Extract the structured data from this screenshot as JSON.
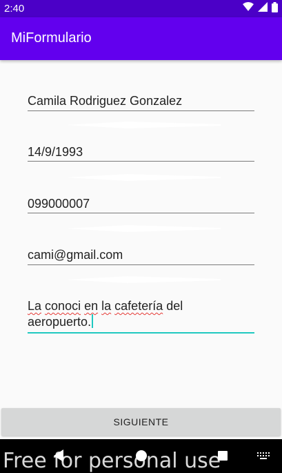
{
  "status_bar": {
    "time": "2:40",
    "icons": [
      "wifi-icon",
      "signal-icon",
      "battery-icon"
    ]
  },
  "app_bar": {
    "title": "MiFormulario",
    "color": "#6200ee"
  },
  "form": {
    "name": "Camila Rodriguez Gonzalez",
    "birthdate": "14/9/1993",
    "phone": "099000007",
    "email": "cami@gmail.com",
    "description_words": [
      "La",
      "conoci",
      "en",
      "la",
      "cafetería",
      "del",
      "aeropuerto."
    ],
    "accent_color": "#1ec8c0"
  },
  "next_button": {
    "label": "SIGUIENTE"
  },
  "nav_bar": {
    "icons": [
      "back-icon",
      "home-icon",
      "recents-icon",
      "keyboard-icon"
    ]
  },
  "watermark": "Free for personal use"
}
